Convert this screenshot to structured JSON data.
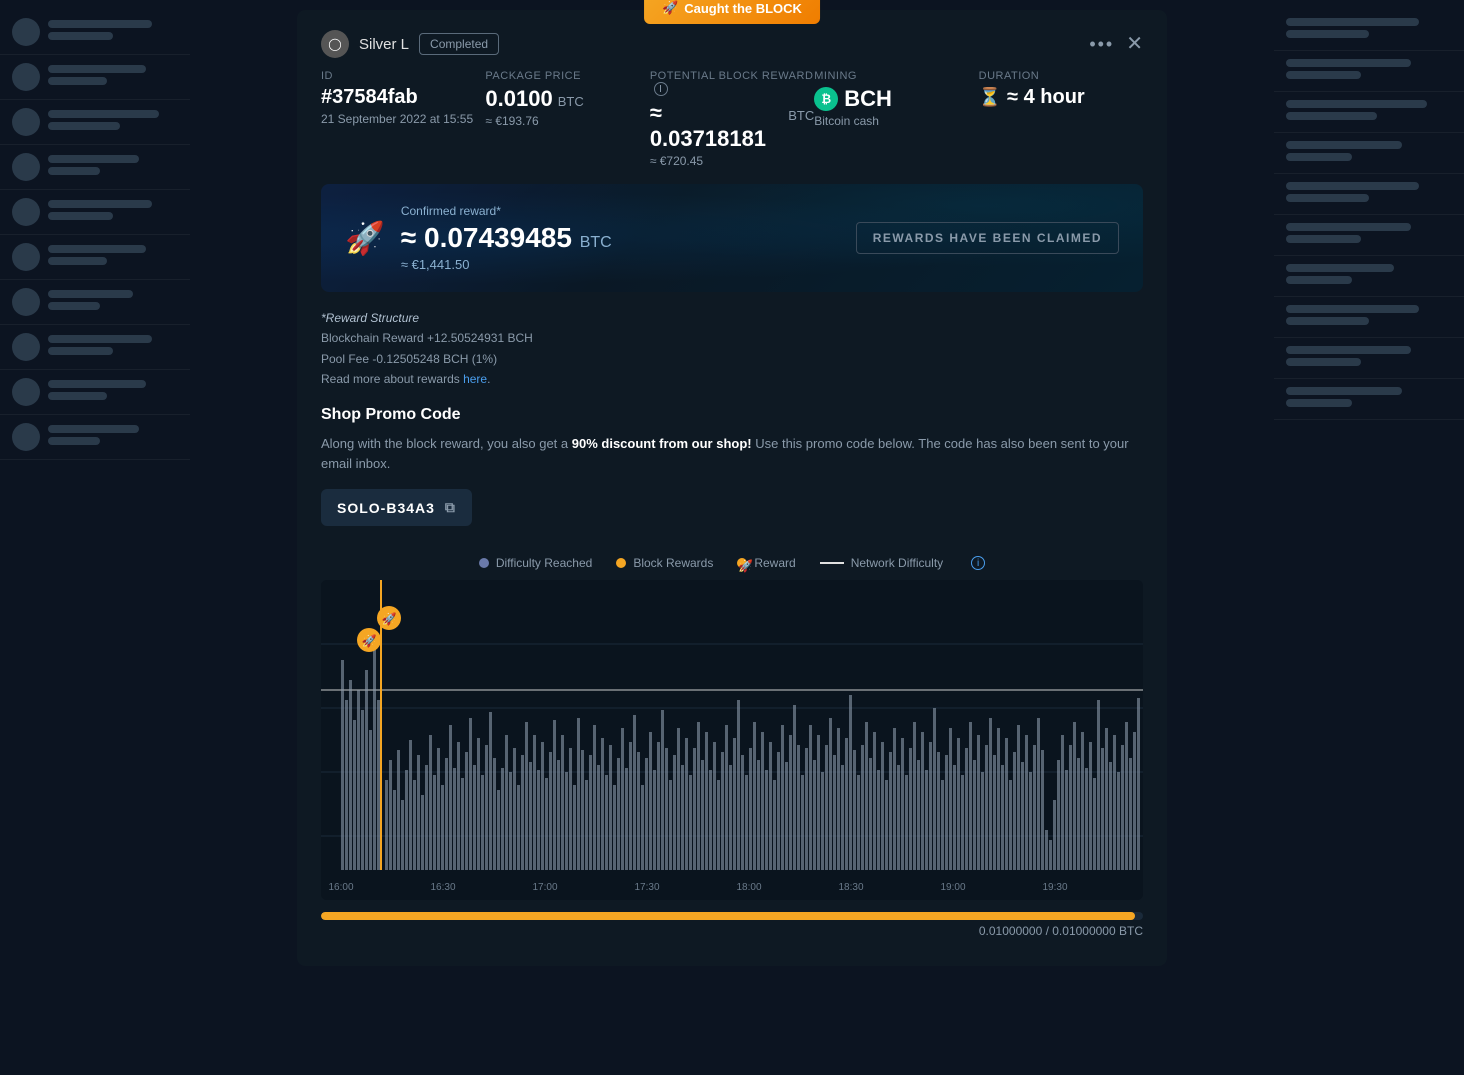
{
  "background": {
    "color": "#0e1520"
  },
  "modal": {
    "caught_block_label": "Caught the BLOCK",
    "user_name": "Silver L",
    "status_badge": "Completed",
    "dots_label": "•••",
    "close_label": "✕",
    "id_label": "ID",
    "id_value": "#37584fab",
    "id_date": "21 September 2022 at 15:55",
    "package_price_label": "Package Price",
    "package_price_value": "0.0100",
    "package_price_unit": "BTC",
    "package_price_eur": "≈ €193.76",
    "potential_reward_label": "Potential Block Reward",
    "potential_reward_value": "≈ 0.03718181",
    "potential_reward_unit": "BTC",
    "potential_reward_eur": "≈ €720.45",
    "mining_label": "Mining",
    "mining_coin": "BCH",
    "mining_name": "Bitcoin cash",
    "duration_label": "Duration",
    "duration_value": "≈ 4 hour",
    "confirmed_label": "Confirmed reward*",
    "confirmed_amount": "≈ 0.07439485",
    "confirmed_unit": "BTC",
    "confirmed_eur": "≈ €1,441.50",
    "claimed_label": "REWARDS HAVE BEEN CLAIMED",
    "reward_structure_title": "*Reward Structure",
    "reward_structure_line1": "Blockchain Reward +12.50524931 BCH",
    "reward_structure_line2": "Pool Fee -0.12505248 BCH (1%)",
    "read_more_prefix": "Read more about rewards ",
    "read_more_link": "here",
    "promo_title": "Shop Promo Code",
    "promo_desc1": "Along with the block reward, you also get a ",
    "promo_desc2": "90% discount from our shop!",
    "promo_desc3": " Use this promo code below. The code has also been sent to your email inbox.",
    "promo_code": "SOLO-B34A3",
    "legend_difficulty_reached": "Difficulty Reached",
    "legend_block_rewards": "Block Rewards",
    "legend_reward": "Reward",
    "legend_network_difficulty": "Network Difficulty",
    "chart_times": [
      "16:00",
      "16:30",
      "17:00",
      "17:30",
      "18:00",
      "18:30",
      "19:00",
      "19:30"
    ],
    "progress_label": "0.01000000 / 0.01000000 BTC"
  },
  "colors": {
    "accent_orange": "#f5a623",
    "accent_blue": "#4a9eed",
    "bch_green": "#0ac18e",
    "difficulty_reached": "#6a7aaa",
    "block_rewards": "#f5a623",
    "reward_rocket": "#f5a623",
    "network_difficulty": "#e0e0e0"
  }
}
